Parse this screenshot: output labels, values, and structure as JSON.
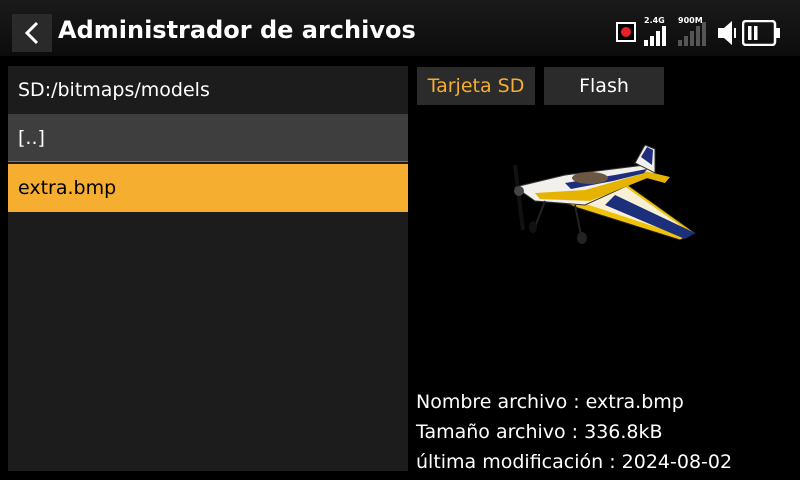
{
  "header": {
    "title": "Administrador de archivos",
    "back_icon": "chevron-left-icon",
    "status": {
      "rf_24_label": "2.4G",
      "rf_900_label": "900M",
      "recording_color": "#e8202a"
    }
  },
  "browser": {
    "path": "SD:/bitmaps/models",
    "items": [
      {
        "label": "[..]"
      },
      {
        "label": "extra.bmp",
        "selected": true
      }
    ]
  },
  "tabs": [
    {
      "label": "Tarjeta SD",
      "active": true
    },
    {
      "label": "Flash",
      "active": false
    }
  ],
  "preview": {
    "image": "airplane-model-image"
  },
  "file_info": {
    "name_line": "Nombre archivo : extra.bmp",
    "size_line": "Tamaño archivo : 336.8kB",
    "date_line": "última modificación : 2024-08-02"
  },
  "colors": {
    "accent": "#f5ae2f",
    "background": "#000000",
    "panel": "#1c1c1c"
  }
}
